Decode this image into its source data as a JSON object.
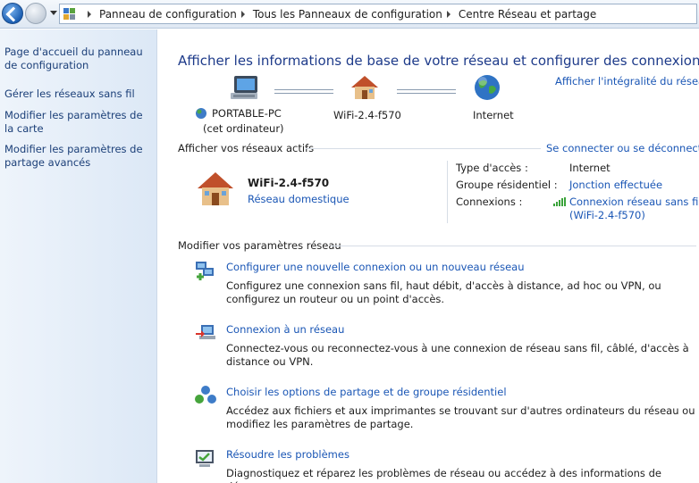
{
  "breadcrumb": [
    "Panneau de configuration",
    "Tous les Panneaux de configuration",
    "Centre Réseau et partage"
  ],
  "sidebar": {
    "links": [
      "Page d'accueil du panneau de configuration",
      "Gérer les réseaux sans fil",
      "Modifier les paramètres de la carte",
      "Modifier les paramètres de partage avancés"
    ]
  },
  "main": {
    "title": "Afficher les informations de base de votre réseau et configurer des connexions",
    "full_map_link": "Afficher l'intégralité du réseau",
    "map": {
      "computer_name": "PORTABLE-PC",
      "computer_sub": "(cet ordinateur)",
      "network_name": "WiFi-2.4-f570",
      "internet_label": "Internet"
    },
    "active": {
      "header": "Afficher vos réseaux actifs",
      "connect_link": "Se connecter ou se déconnecter",
      "network_name": "WiFi-2.4-f570",
      "network_type": "Réseau domestique",
      "access_type_label": "Type d'accès :",
      "access_type_value": "Internet",
      "homegroup_label": "Groupe résidentiel :",
      "homegroup_value": "Jonction effectuée",
      "connections_label": "Connexions :",
      "connection_value_1": "Connexion réseau sans fil",
      "connection_value_2": "(WiFi-2.4-f570)"
    },
    "modify": {
      "header": "Modifier vos paramètres réseau",
      "tasks": [
        {
          "title": "Configurer une nouvelle connexion ou un nouveau réseau",
          "desc": "Configurez une connexion sans fil, haut débit, d'accès à distance, ad hoc ou VPN, ou configurez un routeur ou un point d'accès."
        },
        {
          "title": "Connexion à un réseau",
          "desc": "Connectez-vous ou reconnectez-vous à une connexion de réseau sans fil, câblé, d'accès à distance ou VPN."
        },
        {
          "title": "Choisir les options de partage et de groupe résidentiel",
          "desc": "Accédez aux fichiers et aux imprimantes se trouvant sur d'autres ordinateurs du réseau ou modifiez les paramètres de partage."
        },
        {
          "title": "Résoudre les problèmes",
          "desc": "Diagnostiquez et réparez les problèmes de réseau ou accédez à des informations de dépannage."
        }
      ]
    }
  },
  "colors": {
    "link": "#1a56b5",
    "title": "#1e3b8a",
    "sidebar_link": "#1b3f78"
  }
}
